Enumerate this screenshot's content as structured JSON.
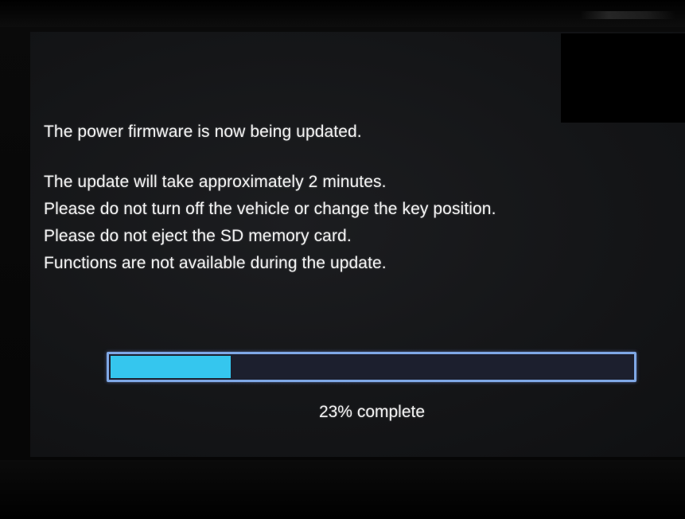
{
  "update_screen": {
    "title": "The power firmware is now being updated.",
    "instructions": [
      "The update will take approximately 2 minutes.",
      "Please do not turn off the vehicle or change the key position.",
      "Please do not eject the SD memory card.",
      "Functions are not available during the update."
    ],
    "progress": {
      "percent": 23,
      "label": "23% complete",
      "fill_color": "#35c6ee",
      "border_color": "#7fa8e6",
      "track_color": "#1c1f2e"
    }
  }
}
